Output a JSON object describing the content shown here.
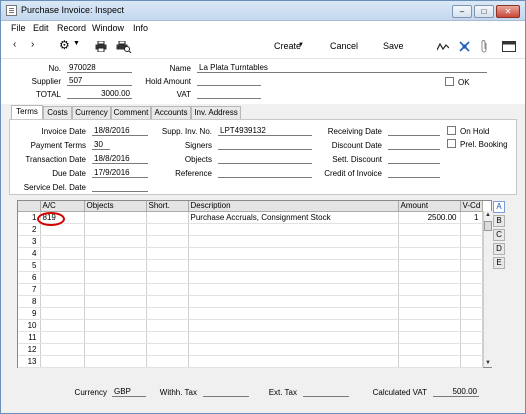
{
  "window": {
    "title": "Purchase Invoice: Inspect"
  },
  "menu": [
    "File",
    "Edit",
    "Record",
    "Window",
    "Info"
  ],
  "toolbar": {
    "create_label": "Create",
    "cancel_label": "Cancel",
    "save_label": "Save"
  },
  "header": {
    "no_label": "No.",
    "no_value": "970028",
    "supplier_label": "Supplier",
    "supplier_value": "507",
    "total_label": "TOTAL",
    "total_value": "3000.00",
    "name_label": "Name",
    "name_value": "La Plata Turntables",
    "hold_amount_label": "Hold Amount",
    "hold_amount_value": "",
    "vat_label": "VAT",
    "vat_value": "",
    "ok_label": "OK"
  },
  "tabs": [
    "Terms",
    "Costs",
    "Currency",
    "Comment",
    "Accounts",
    "Inv. Address"
  ],
  "terms": {
    "invoice_date_label": "Invoice Date",
    "invoice_date_value": "18/8/2016",
    "payment_terms_label": "Payment Terms",
    "payment_terms_value": "30",
    "transaction_date_label": "Transaction Date",
    "transaction_date_value": "18/8/2016",
    "due_date_label": "Due Date",
    "due_date_value": "17/9/2016",
    "service_del_date_label": "Service Del. Date",
    "service_del_date_value": "",
    "supp_inv_no_label": "Supp. Inv. No.",
    "supp_inv_no_value": "LPT4939132",
    "signers_label": "Signers",
    "signers_value": "",
    "objects_label": "Objects",
    "objects_value": "",
    "reference_label": "Reference",
    "reference_value": "",
    "receiving_date_label": "Receiving Date",
    "receiving_date_value": "",
    "discount_date_label": "Discount Date",
    "discount_date_value": "",
    "sett_discount_label": "Sett. Discount",
    "sett_discount_value": "",
    "credit_of_invoice_label": "Credit of Invoice",
    "credit_of_invoice_value": "",
    "on_hold_label": "On Hold",
    "prel_booking_label": "Prel. Booking"
  },
  "grid": {
    "columns": [
      "",
      "A/C",
      "Objects",
      "Short.",
      "Description",
      "Amount",
      "V-Cd"
    ],
    "rows": [
      [
        "1",
        "819",
        "",
        "",
        "Purchase Accruals, Consignment Stock",
        "2500.00",
        "1"
      ],
      [
        "2",
        "",
        "",
        "",
        "",
        "",
        ""
      ],
      [
        "3",
        "",
        "",
        "",
        "",
        "",
        ""
      ],
      [
        "4",
        "",
        "",
        "",
        "",
        "",
        ""
      ],
      [
        "5",
        "",
        "",
        "",
        "",
        "",
        ""
      ],
      [
        "6",
        "",
        "",
        "",
        "",
        "",
        ""
      ],
      [
        "7",
        "",
        "",
        "",
        "",
        "",
        ""
      ],
      [
        "8",
        "",
        "",
        "",
        "",
        "",
        ""
      ],
      [
        "9",
        "",
        "",
        "",
        "",
        "",
        ""
      ],
      [
        "10",
        "",
        "",
        "",
        "",
        "",
        ""
      ],
      [
        "11",
        "",
        "",
        "",
        "",
        "",
        ""
      ],
      [
        "12",
        "",
        "",
        "",
        "",
        "",
        ""
      ],
      [
        "13",
        "",
        "",
        "",
        "",
        "",
        ""
      ]
    ],
    "side_tabs": [
      "A",
      "B",
      "C",
      "D",
      "E"
    ]
  },
  "footer": {
    "currency_label": "Currency",
    "currency_value": "GBP",
    "withh_tax_label": "Withh. Tax",
    "withh_tax_value": "",
    "ext_tax_label": "Ext. Tax",
    "ext_tax_value": "",
    "calculated_vat_label": "Calculated VAT",
    "calculated_vat_value": "500.00"
  },
  "colors": {
    "highlight_circle": "#d40000",
    "title_gradient": "#c3d7ee"
  }
}
